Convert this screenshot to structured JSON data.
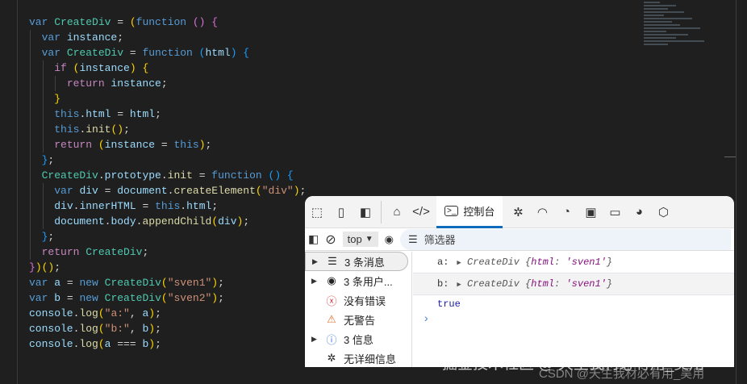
{
  "code": [
    {
      "indent": 0,
      "tokens": [
        [
          "k",
          "var "
        ],
        [
          "c",
          "CreateDiv"
        ],
        [
          "t",
          " = "
        ],
        [
          "p1",
          "("
        ],
        [
          "k",
          "function "
        ],
        [
          "p2",
          "() {"
        ]
      ]
    },
    {
      "indent": 1,
      "tokens": [
        [
          "k",
          "var "
        ],
        [
          "v",
          "instance"
        ],
        [
          "t",
          ";"
        ]
      ]
    },
    {
      "indent": 1,
      "tokens": [
        [
          "k",
          "var "
        ],
        [
          "c",
          "CreateDiv"
        ],
        [
          "t",
          " = "
        ],
        [
          "k",
          "function "
        ],
        [
          "p3",
          "("
        ],
        [
          "v",
          "html"
        ],
        [
          "p3",
          ") {"
        ]
      ]
    },
    {
      "indent": 2,
      "tokens": [
        [
          "r",
          "if "
        ],
        [
          "p1",
          "("
        ],
        [
          "v",
          "instance"
        ],
        [
          "p1",
          ") {"
        ]
      ]
    },
    {
      "indent": 3,
      "tokens": [
        [
          "r",
          "return "
        ],
        [
          "v",
          "instance"
        ],
        [
          "t",
          ";"
        ]
      ]
    },
    {
      "indent": 2,
      "tokens": [
        [
          "p1",
          "}"
        ]
      ]
    },
    {
      "indent": 2,
      "tokens": [
        [
          "k",
          "this"
        ],
        [
          "t",
          "."
        ],
        [
          "v",
          "html"
        ],
        [
          "t",
          " = "
        ],
        [
          "v",
          "html"
        ],
        [
          "t",
          ";"
        ]
      ]
    },
    {
      "indent": 2,
      "tokens": [
        [
          "k",
          "this"
        ],
        [
          "t",
          "."
        ],
        [
          "m",
          "init"
        ],
        [
          "p1",
          "()"
        ],
        [
          "t",
          ";"
        ]
      ]
    },
    {
      "indent": 2,
      "tokens": [
        [
          "r",
          "return "
        ],
        [
          "p1",
          "("
        ],
        [
          "v",
          "instance"
        ],
        [
          "t",
          " = "
        ],
        [
          "k",
          "this"
        ],
        [
          "p1",
          ")"
        ],
        [
          "t",
          ";"
        ]
      ]
    },
    {
      "indent": 1,
      "tokens": [
        [
          "p3",
          "}"
        ],
        [
          "t",
          ";"
        ]
      ]
    },
    {
      "indent": 1,
      "tokens": [
        [
          "c",
          "CreateDiv"
        ],
        [
          "t",
          "."
        ],
        [
          "v",
          "prototype"
        ],
        [
          "t",
          "."
        ],
        [
          "m",
          "init"
        ],
        [
          "t",
          " = "
        ],
        [
          "k",
          "function "
        ],
        [
          "p3",
          "() {"
        ]
      ]
    },
    {
      "indent": 2,
      "tokens": [
        [
          "k",
          "var "
        ],
        [
          "v",
          "div"
        ],
        [
          "t",
          " = "
        ],
        [
          "v",
          "document"
        ],
        [
          "t",
          "."
        ],
        [
          "m",
          "createElement"
        ],
        [
          "p1",
          "("
        ],
        [
          "s",
          "\"div\""
        ],
        [
          "p1",
          ")"
        ],
        [
          "t",
          ";"
        ]
      ]
    },
    {
      "indent": 2,
      "tokens": [
        [
          "v",
          "div"
        ],
        [
          "t",
          "."
        ],
        [
          "v",
          "innerHTML"
        ],
        [
          "t",
          " = "
        ],
        [
          "k",
          "this"
        ],
        [
          "t",
          "."
        ],
        [
          "v",
          "html"
        ],
        [
          "t",
          ";"
        ]
      ]
    },
    {
      "indent": 2,
      "tokens": [
        [
          "v",
          "document"
        ],
        [
          "t",
          "."
        ],
        [
          "v",
          "body"
        ],
        [
          "t",
          "."
        ],
        [
          "m",
          "appendChild"
        ],
        [
          "p1",
          "("
        ],
        [
          "v",
          "div"
        ],
        [
          "p1",
          ")"
        ],
        [
          "t",
          ";"
        ]
      ]
    },
    {
      "indent": 1,
      "tokens": [
        [
          "p3",
          "}"
        ],
        [
          "t",
          ";"
        ]
      ]
    },
    {
      "indent": 1,
      "tokens": [
        [
          "r",
          "return "
        ],
        [
          "c",
          "CreateDiv"
        ],
        [
          "t",
          ";"
        ]
      ]
    },
    {
      "indent": 0,
      "tokens": [
        [
          "p2",
          "}"
        ],
        [
          "p1",
          ")"
        ],
        [
          "p1",
          "()"
        ],
        [
          "t",
          ";"
        ]
      ]
    },
    {
      "indent": 0,
      "tokens": [
        [
          "k",
          "var "
        ],
        [
          "v",
          "a"
        ],
        [
          "t",
          " = "
        ],
        [
          "k",
          "new "
        ],
        [
          "c",
          "CreateDiv"
        ],
        [
          "p1",
          "("
        ],
        [
          "s",
          "\"sven1\""
        ],
        [
          "p1",
          ")"
        ],
        [
          "t",
          ";"
        ]
      ]
    },
    {
      "indent": 0,
      "tokens": [
        [
          "k",
          "var "
        ],
        [
          "v",
          "b"
        ],
        [
          "t",
          " = "
        ],
        [
          "k",
          "new "
        ],
        [
          "c",
          "CreateDiv"
        ],
        [
          "p1",
          "("
        ],
        [
          "s",
          "\"sven2\""
        ],
        [
          "p1",
          ")"
        ],
        [
          "t",
          ";"
        ]
      ]
    },
    {
      "indent": 0,
      "tokens": [
        [
          "v",
          "console"
        ],
        [
          "t",
          "."
        ],
        [
          "m",
          "log"
        ],
        [
          "p1",
          "("
        ],
        [
          "s",
          "\"a:\""
        ],
        [
          "t",
          ", "
        ],
        [
          "v",
          "a"
        ],
        [
          "p1",
          ")"
        ],
        [
          "t",
          ";"
        ]
      ]
    },
    {
      "indent": 0,
      "tokens": [
        [
          "v",
          "console"
        ],
        [
          "t",
          "."
        ],
        [
          "m",
          "log"
        ],
        [
          "p1",
          "("
        ],
        [
          "s",
          "\"b:\""
        ],
        [
          "t",
          ", "
        ],
        [
          "v",
          "b"
        ],
        [
          "p1",
          ")"
        ],
        [
          "t",
          ";"
        ]
      ]
    },
    {
      "indent": 0,
      "tokens": [
        [
          "v",
          "console"
        ],
        [
          "t",
          "."
        ],
        [
          "m",
          "log"
        ],
        [
          "p1",
          "("
        ],
        [
          "v",
          "a"
        ],
        [
          "t",
          " === "
        ],
        [
          "v",
          "b"
        ],
        [
          "p1",
          ")"
        ],
        [
          "t",
          ";"
        ]
      ]
    }
  ],
  "devtools": {
    "console_tab": "控制台",
    "context": "top",
    "filter_placeholder": "筛选器",
    "sidebar": [
      "3 条消息",
      "3 条用户...",
      "没有错误",
      "无警告",
      "3 信息",
      "无详细信息"
    ],
    "output": [
      {
        "label": "a:",
        "cls": "CreateDiv",
        "key": "html",
        "val": "'sven1'"
      },
      {
        "label": "b:",
        "cls": "CreateDiv",
        "key": "html",
        "val": "'sven1'"
      }
    ],
    "result": "true"
  },
  "watermark": {
    "line1": "掘金技术社区 @ 天生我材必有用_吴用",
    "line2": "CSDN @天生我材必有用_吴用"
  }
}
